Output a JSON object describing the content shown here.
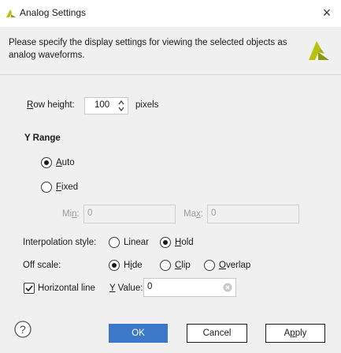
{
  "window": {
    "title": "Analog Settings",
    "close_glyph": "×",
    "logo_icon": "vivado-logo-icon",
    "accent_color": "#3c78c8",
    "logo_color": "#b8c010"
  },
  "description": "Please specify the display settings for viewing the selected objects as analog waveforms.",
  "row_height": {
    "label_underlined": "R",
    "label_rest": "ow height:",
    "value": "100",
    "unit": "pixels"
  },
  "y_range": {
    "heading": "Y Range",
    "auto": {
      "underlined": "A",
      "rest": "uto",
      "checked": true
    },
    "fixed": {
      "underlined": "F",
      "rest": "ixed",
      "checked": false
    },
    "min": {
      "label_pre": "Mi",
      "label_underlined": "n",
      "label_post": ":",
      "value": "0"
    },
    "max": {
      "label_pre": "Ma",
      "label_underlined": "x",
      "label_post": ":",
      "value": "0"
    }
  },
  "interpolation": {
    "label": "Interpolation style:",
    "linear": {
      "label": "Linear",
      "checked": false
    },
    "hold": {
      "underlined": "H",
      "rest": "old",
      "checked": true
    }
  },
  "off_scale": {
    "label": "Off scale:",
    "hide": {
      "pre": "H",
      "underlined": "i",
      "post": "de",
      "checked": true
    },
    "clip": {
      "underlined": "C",
      "rest": "lip",
      "checked": false
    },
    "overlap": {
      "underlined": "O",
      "rest": "verlap",
      "checked": false
    }
  },
  "horizontal_line": {
    "label": "Horizontal line",
    "checked": true,
    "y_value_underlined": "Y",
    "y_value_rest": " Value:",
    "y_value": "0"
  },
  "buttons": {
    "ok": "OK",
    "cancel": "Cancel",
    "apply_pre": "A",
    "apply_underlined": "p",
    "apply_post": "ply",
    "help_glyph": "?"
  }
}
